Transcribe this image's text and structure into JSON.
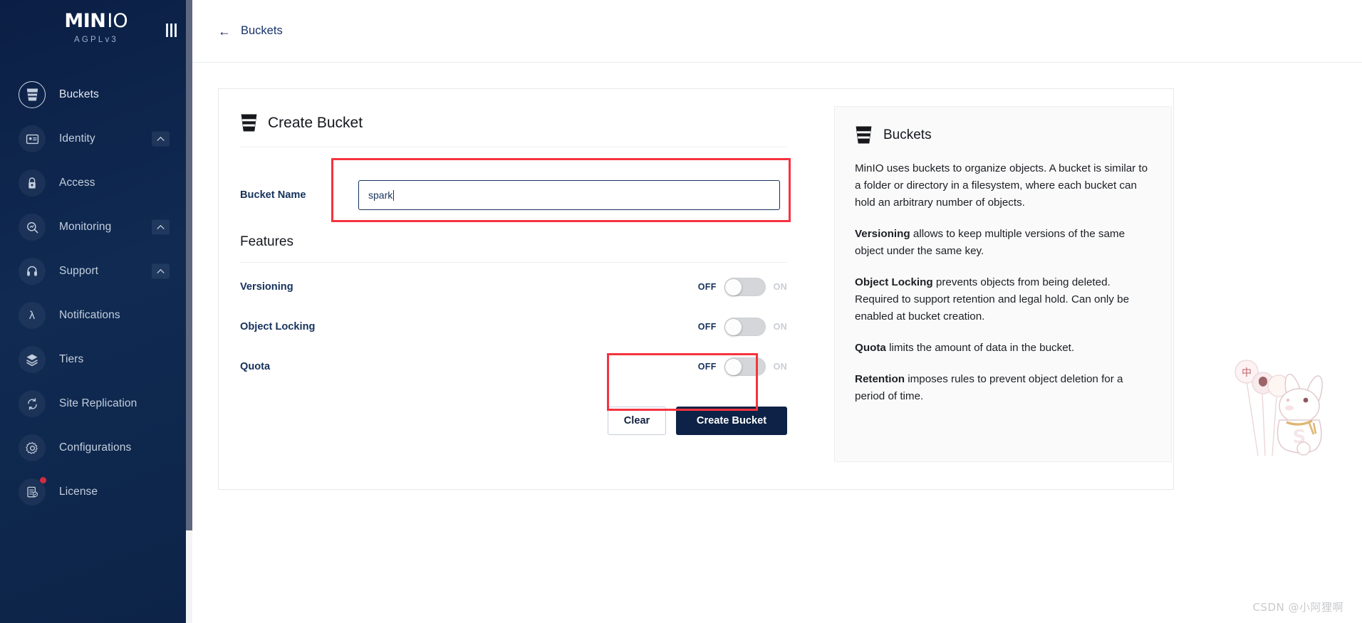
{
  "sidebar": {
    "logo": {
      "part1": "MIN",
      "part2": "IO",
      "license": "AGPLv3"
    },
    "collapse_label": "collapse-menu",
    "items": [
      {
        "label": "Buckets",
        "icon": "bucket-icon",
        "active": true,
        "chevron": false,
        "badge": false
      },
      {
        "label": "Identity",
        "icon": "identity-card-icon",
        "active": false,
        "chevron": true,
        "badge": false
      },
      {
        "label": "Access",
        "icon": "lock-icon",
        "active": false,
        "chevron": false,
        "badge": false
      },
      {
        "label": "Monitoring",
        "icon": "magnifier-chart-icon",
        "active": false,
        "chevron": true,
        "badge": false
      },
      {
        "label": "Support",
        "icon": "headset-icon",
        "active": false,
        "chevron": true,
        "badge": false
      },
      {
        "label": "Notifications",
        "icon": "lambda-icon",
        "active": false,
        "chevron": false,
        "badge": false
      },
      {
        "label": "Tiers",
        "icon": "layers-icon",
        "active": false,
        "chevron": false,
        "badge": false
      },
      {
        "label": "Site Replication",
        "icon": "sync-icon",
        "active": false,
        "chevron": false,
        "badge": false
      },
      {
        "label": "Configurations",
        "icon": "gear-icon",
        "active": false,
        "chevron": false,
        "badge": false
      },
      {
        "label": "License",
        "icon": "license-doc-icon",
        "active": false,
        "chevron": false,
        "badge": true
      }
    ]
  },
  "topbar": {
    "back_arrow": "←",
    "breadcrumb": "Buckets"
  },
  "form": {
    "title": "Create Bucket",
    "bucket_name_label": "Bucket Name",
    "bucket_name_value": "spark",
    "bucket_name_placeholder": "",
    "features_title": "Features",
    "toggle_off_label": "OFF",
    "toggle_on_label": "ON",
    "features": [
      {
        "label": "Versioning",
        "state": "OFF"
      },
      {
        "label": "Object Locking",
        "state": "OFF"
      },
      {
        "label": "Quota",
        "state": "OFF"
      }
    ],
    "clear_button": "Clear",
    "create_button": "Create Bucket"
  },
  "info": {
    "title": "Buckets",
    "paragraphs": [
      {
        "bold": "",
        "text": "MinIO uses buckets to organize objects. A bucket is similar to a folder or directory in a filesystem, where each bucket can hold an arbitrary number of objects."
      },
      {
        "bold": "Versioning",
        "text": " allows to keep multiple versions of the same object under the same key."
      },
      {
        "bold": "Object Locking",
        "text": " prevents objects from being deleted. Required to support retention and legal hold. Can only be enabled at bucket creation."
      },
      {
        "bold": "Quota",
        "text": " limits the amount of data in the bucket."
      },
      {
        "bold": "Retention",
        "text": " imposes rules to prevent object deletion for a period of time."
      }
    ]
  },
  "decorations": {
    "watermark": "CSDN @小阿狸啊"
  },
  "colors": {
    "sidebar_bg": "#0d2244",
    "accent_navy": "#0d2246",
    "annotation_red": "#f5333f",
    "badge_red": "#d12b3f",
    "toggle_track": "#d4d6da"
  }
}
